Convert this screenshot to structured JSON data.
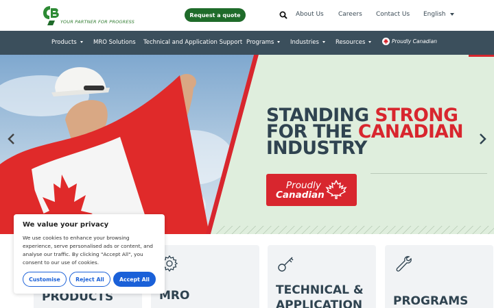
{
  "header": {
    "tagline": "YOUR PARTNER FOR PROGRESS",
    "quote_button": "Request a quote",
    "links": [
      "About Us",
      "Careers",
      "Contact Us"
    ],
    "language": "English"
  },
  "nav": {
    "items": [
      "Products",
      "MRO Solutions",
      "Technical and Application Support",
      "Programs",
      "Industries",
      "Resources"
    ],
    "proudly_canadian": "Proudly Canadian"
  },
  "hero": {
    "line1_a": "STANDING ",
    "line1_b": "STRONG",
    "line2_a": "FOR THE ",
    "line2_b": "CANADIAN",
    "line3": "INDUSTRY",
    "badge_line1": "Proudly",
    "badge_line2": "Canadian"
  },
  "cards": [
    {
      "title1": "PRODUCTS",
      "title2": "",
      "icon": "box-icon"
    },
    {
      "title1": "MRO",
      "title2": "",
      "icon": "gear-icon"
    },
    {
      "title1": "TECHNICAL &",
      "title2": "APPLICATION",
      "icon": "key-icon"
    },
    {
      "title1": "PROGRAMS",
      "title2": "",
      "icon": "wrench-icon"
    }
  ],
  "cookie": {
    "title": "We value your privacy",
    "text": "We use cookies to enhance your browsing experience, serve personalised ads or content, and analyse our traffic. By clicking \"Accept All\", you consent to our use of cookies.",
    "customise": "Customise",
    "reject": "Reject All",
    "accept": "Accept All"
  },
  "colors": {
    "brand_green": "#1f6b2a",
    "nav_bg": "#3b4f5c",
    "accent_red": "#d8262e",
    "cookie_blue": "#1a60d8"
  }
}
